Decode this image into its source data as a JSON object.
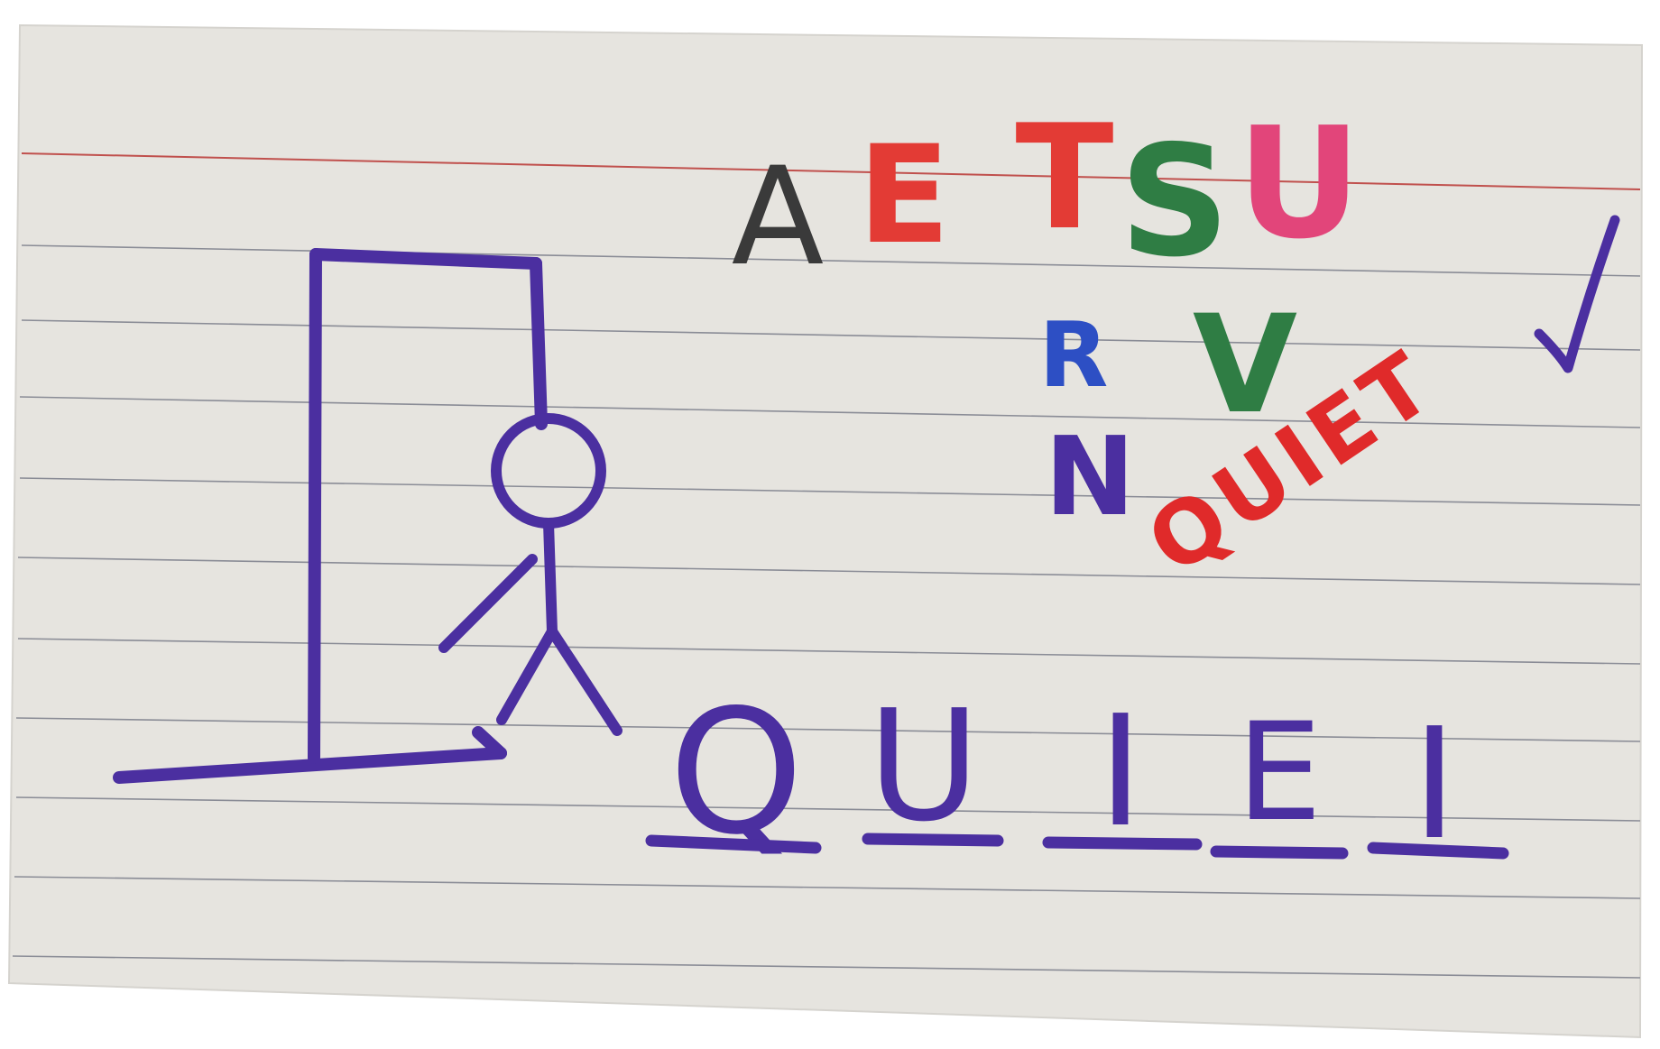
{
  "card": {
    "paper_color": "#e6e4df",
    "rule_color": "#8a8c96",
    "margin_line_color": "#c0504d",
    "pen_color": "#4b2fa0"
  },
  "guessed_letters": [
    {
      "letter": "A",
      "color": "#3a3a3a"
    },
    {
      "letter": "E",
      "color": "#e33b35"
    },
    {
      "letter": "T",
      "color": "#e33b35"
    },
    {
      "letter": "S",
      "color": "#2f7d44"
    },
    {
      "letter": "U",
      "color": "#e2457a"
    },
    {
      "letter": "R",
      "color": "#2d4fc4"
    },
    {
      "letter": "V",
      "color": "#2f7d44"
    },
    {
      "letter": "N",
      "color": "#4b2fa0"
    }
  ],
  "guess": {
    "text": "QUIET",
    "color": "#e02a2a"
  },
  "checkmark_icon": "check-icon",
  "word_slots": [
    "Q",
    "U",
    "I",
    "E",
    "I"
  ],
  "gallows": {
    "parts_drawn": [
      "head",
      "body",
      "left-arm",
      "left-leg",
      "right-leg"
    ]
  }
}
